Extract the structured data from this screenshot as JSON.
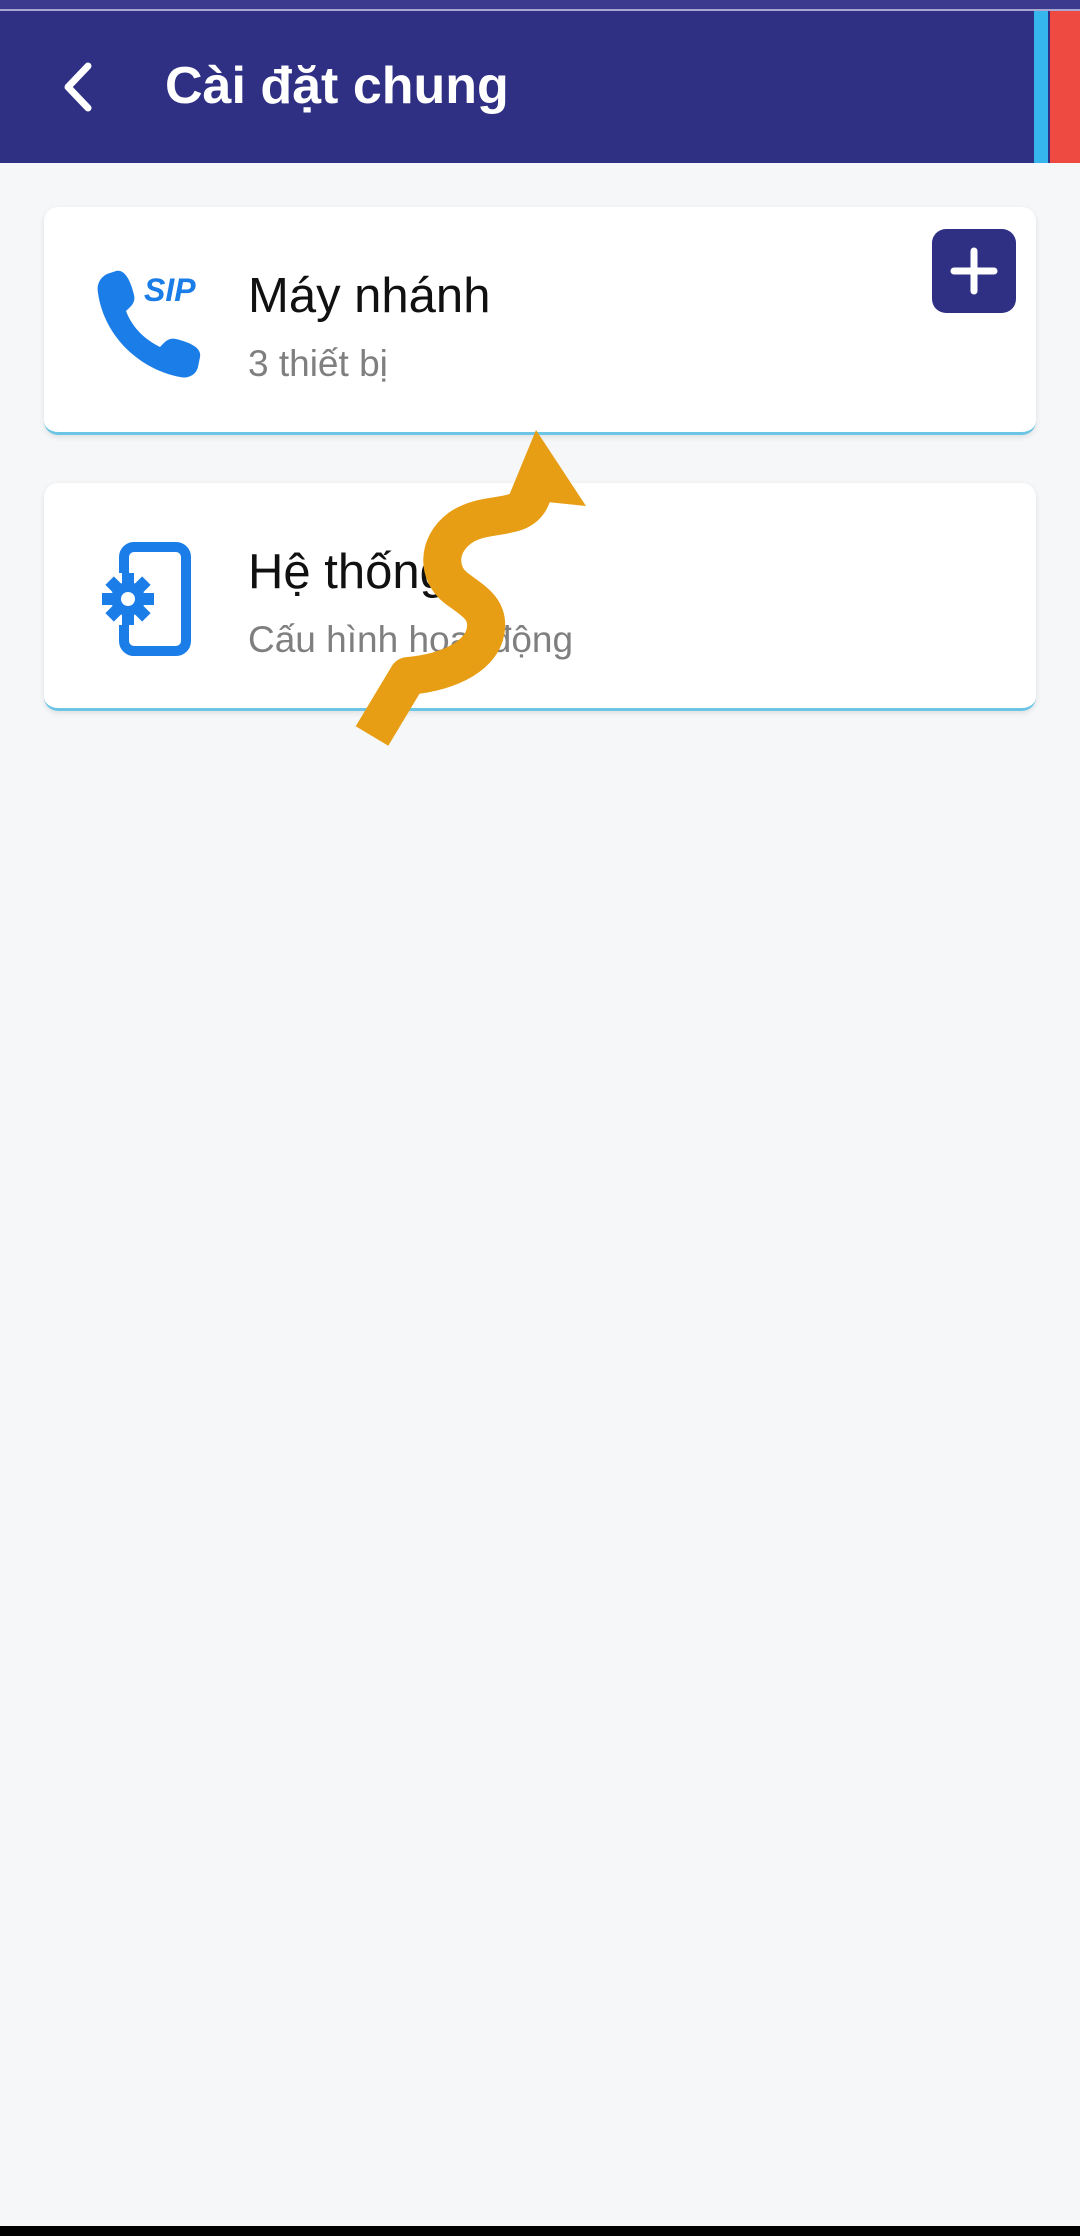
{
  "app_bar": {
    "title": "Cài đặt chung",
    "back_icon": "chevron-left-icon",
    "background": "#2f3084"
  },
  "cards": [
    {
      "icon": "sip-phone-icon",
      "icon_text": "SIP",
      "title": "Máy nhánh",
      "subtitle": "3 thiết bị",
      "action_icon": "plus-icon"
    },
    {
      "icon": "settings-phone-icon",
      "title": "Hệ thống",
      "subtitle": "Cấu hình hoạt động"
    }
  ],
  "overlay": {
    "icon": "squiggle-arrow-icon",
    "color": "#e89e14"
  },
  "colors": {
    "accent_blue": "#1a7de8",
    "card_border": "#6cc5e4",
    "edge_blue": "#35b6ec",
    "edge_red": "#ef4a41"
  }
}
